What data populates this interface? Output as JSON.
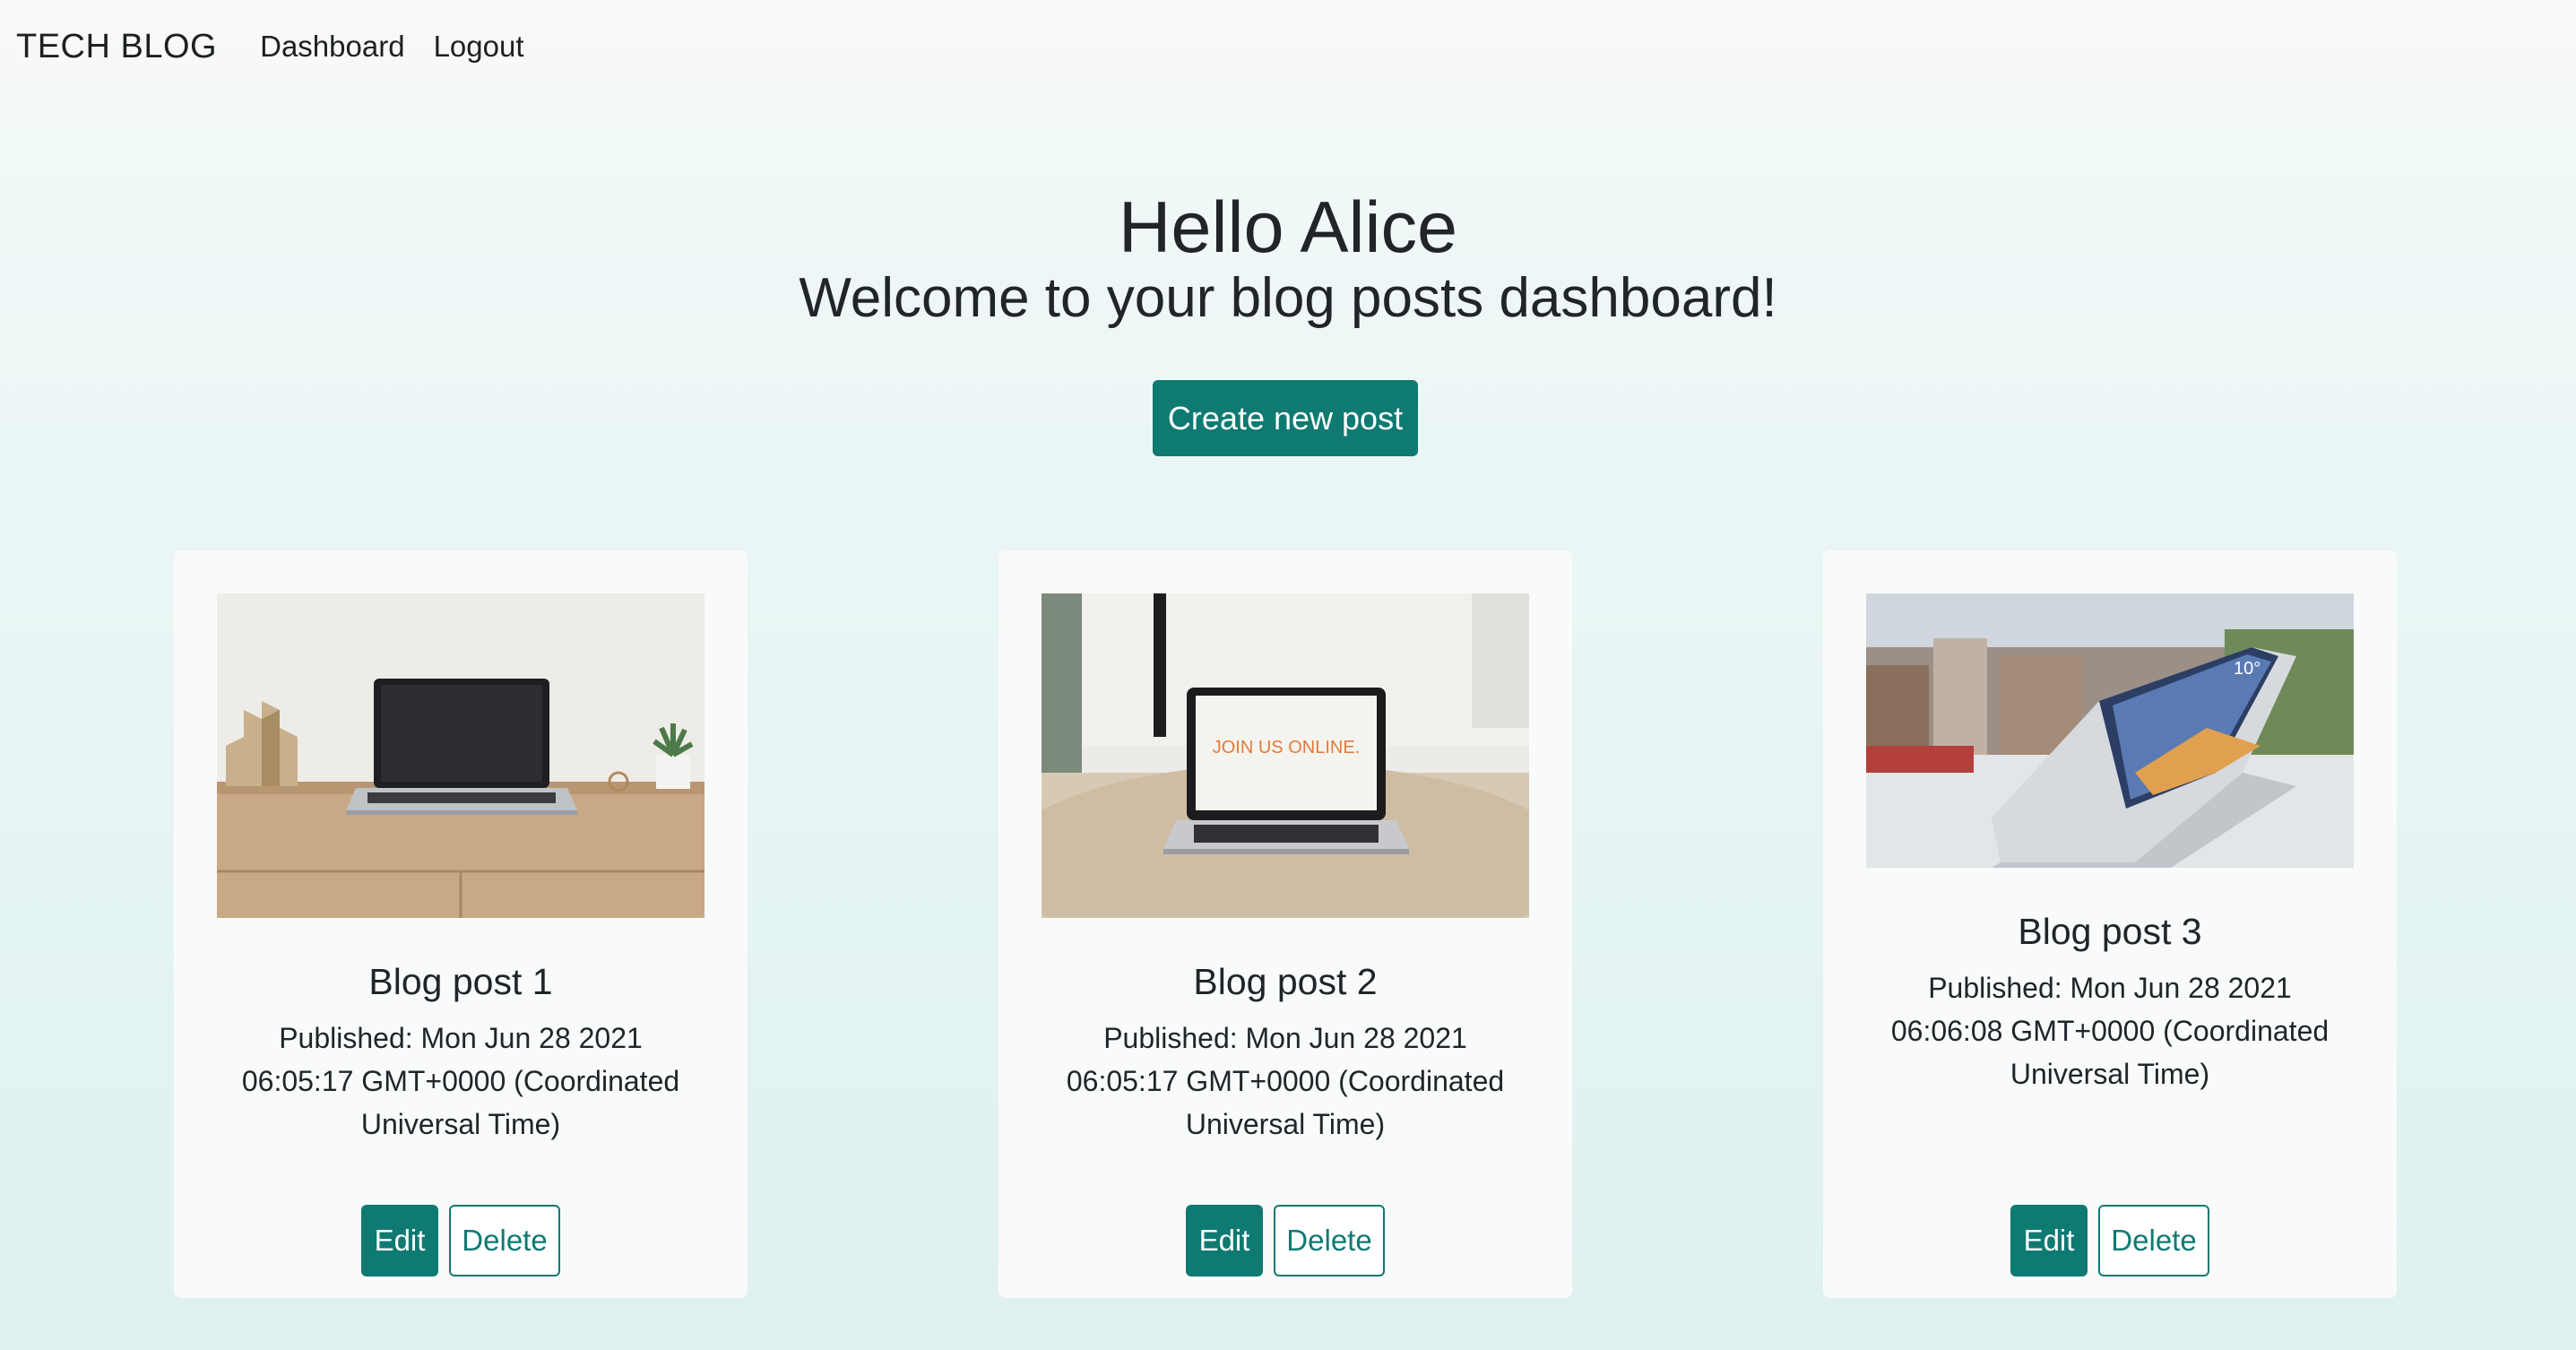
{
  "nav": {
    "brand": "TECH BLOG",
    "links": [
      "Dashboard",
      "Logout"
    ]
  },
  "hero": {
    "greeting": "Hello Alice",
    "subtitle": "Welcome to your blog posts dashboard!",
    "create_button": "Create new post"
  },
  "posts": [
    {
      "title": "Blog post 1",
      "published_line1": "Published: Mon Jun 28 2021",
      "published_line2": "06:05:17 GMT+0000 (Coordinated",
      "published_line3": "Universal Time)",
      "image": "laptop-on-wooden-desk",
      "edit_label": "Edit",
      "delete_label": "Delete"
    },
    {
      "title": "Blog post 2",
      "published_line1": "Published: Mon Jun 28 2021",
      "published_line2": "06:05:17 GMT+0000 (Coordinated",
      "published_line3": "Universal Time)",
      "image": "laptop-join-us-online",
      "screen_text": "JOIN US ONLINE.",
      "edit_label": "Edit",
      "delete_label": "Delete"
    },
    {
      "title": "Blog post 3",
      "published_line1": "Published: Mon Jun 28 2021",
      "published_line2": "06:06:08 GMT+0000 (Coordinated",
      "published_line3": "Universal Time)",
      "image": "laptop-city-view",
      "edit_label": "Edit",
      "delete_label": "Delete"
    }
  ],
  "colors": {
    "accent": "#0e7a72",
    "card_bg": "#f9fbfb",
    "text": "#212529"
  }
}
